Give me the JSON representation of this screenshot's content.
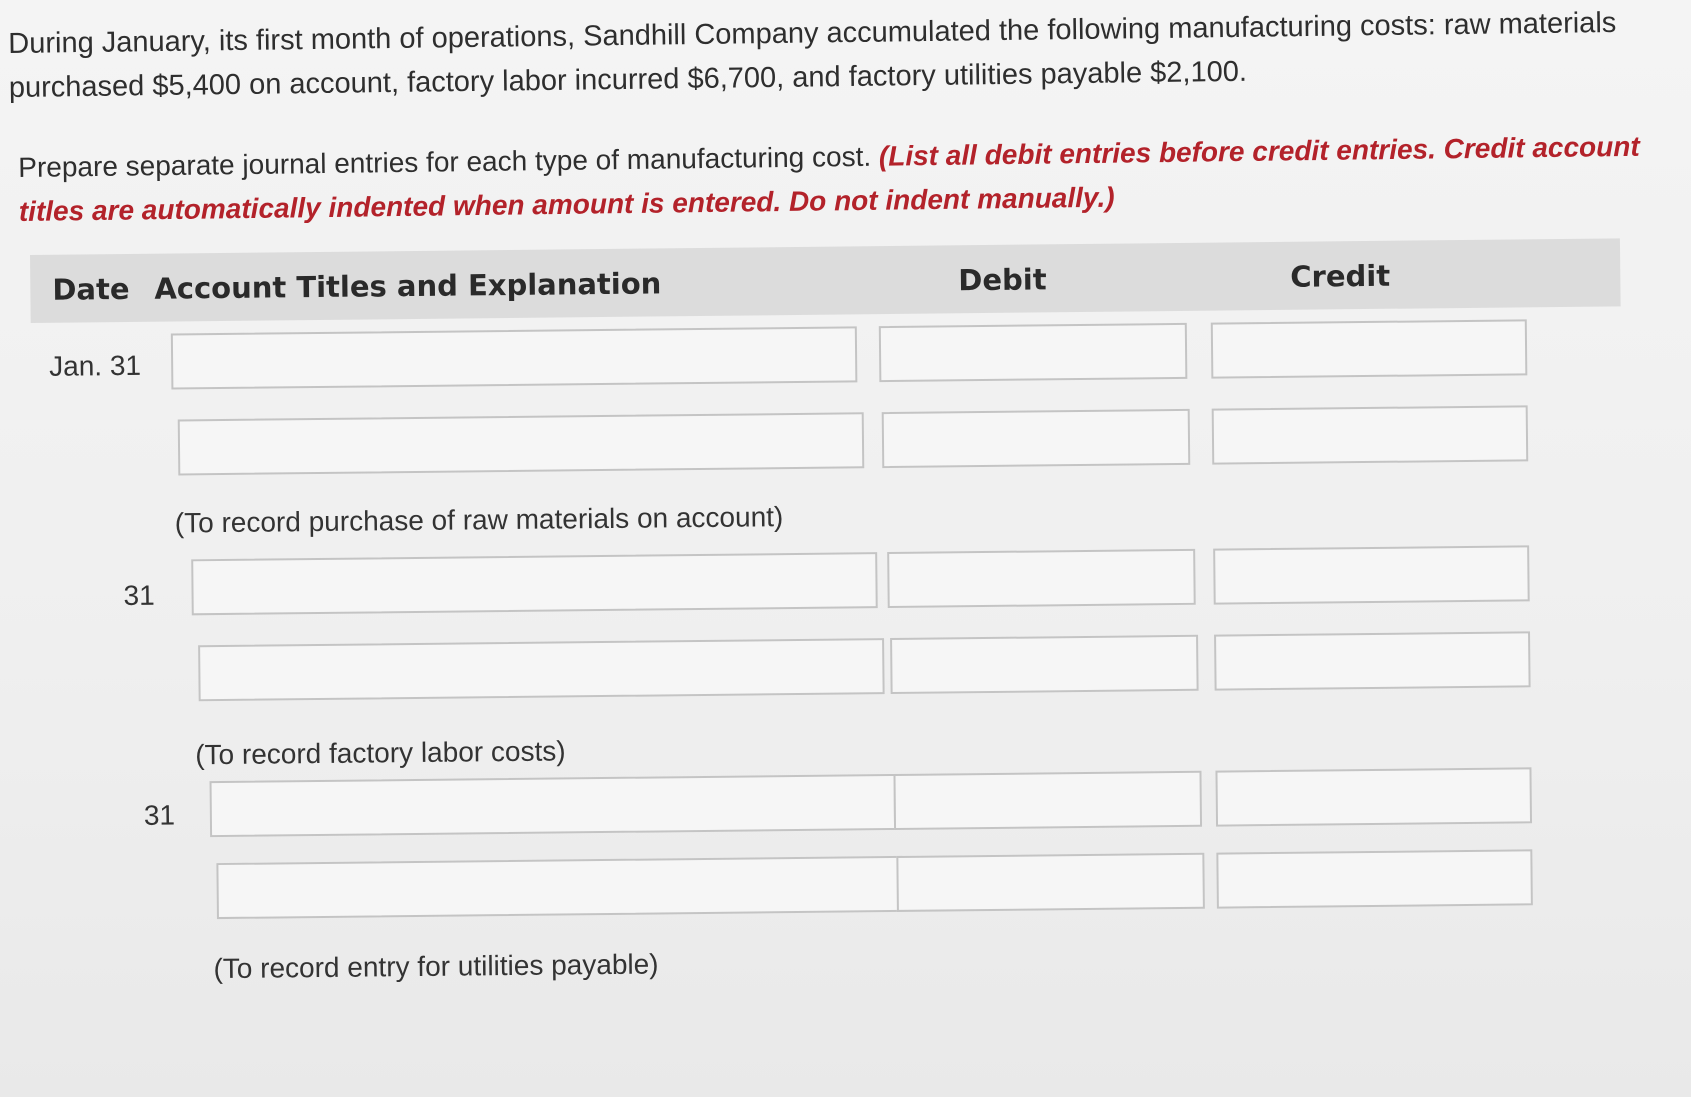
{
  "problem": {
    "line1": "During January, its first month of operations, Sandhill Company accumulated the following manufacturing costs: raw materials",
    "line2": "purchased $5,400 on account, factory labor incurred $6,700, and factory utilities payable $2,100."
  },
  "instructions": {
    "normal": "Prepare separate journal entries for each type of manufacturing cost. ",
    "red_line1": "(List all debit entries before credit entries. Credit account",
    "red_line2": "titles are automatically indented when amount is entered. Do not indent manually.)"
  },
  "table": {
    "headers": {
      "date": "Date",
      "account": "Account Titles and Explanation",
      "debit": "Debit",
      "credit": "Credit"
    },
    "entries": [
      {
        "date": "Jan. 31",
        "rows": [
          {
            "account": "",
            "debit": "",
            "credit": ""
          },
          {
            "account": "",
            "debit": "",
            "credit": ""
          }
        ],
        "explanation": "(To record purchase of raw materials on account)"
      },
      {
        "date": "31",
        "rows": [
          {
            "account": "",
            "debit": "",
            "credit": ""
          },
          {
            "account": "",
            "debit": "",
            "credit": ""
          }
        ],
        "explanation": "(To record factory labor costs)"
      },
      {
        "date": "31",
        "rows": [
          {
            "account": "",
            "debit": "",
            "credit": ""
          },
          {
            "account": "",
            "debit": "",
            "credit": ""
          }
        ],
        "explanation": "(To record entry for utilities payable)"
      }
    ]
  },
  "colors": {
    "instruction_red": "#b3222a",
    "header_bg": "#dcdcdc"
  }
}
